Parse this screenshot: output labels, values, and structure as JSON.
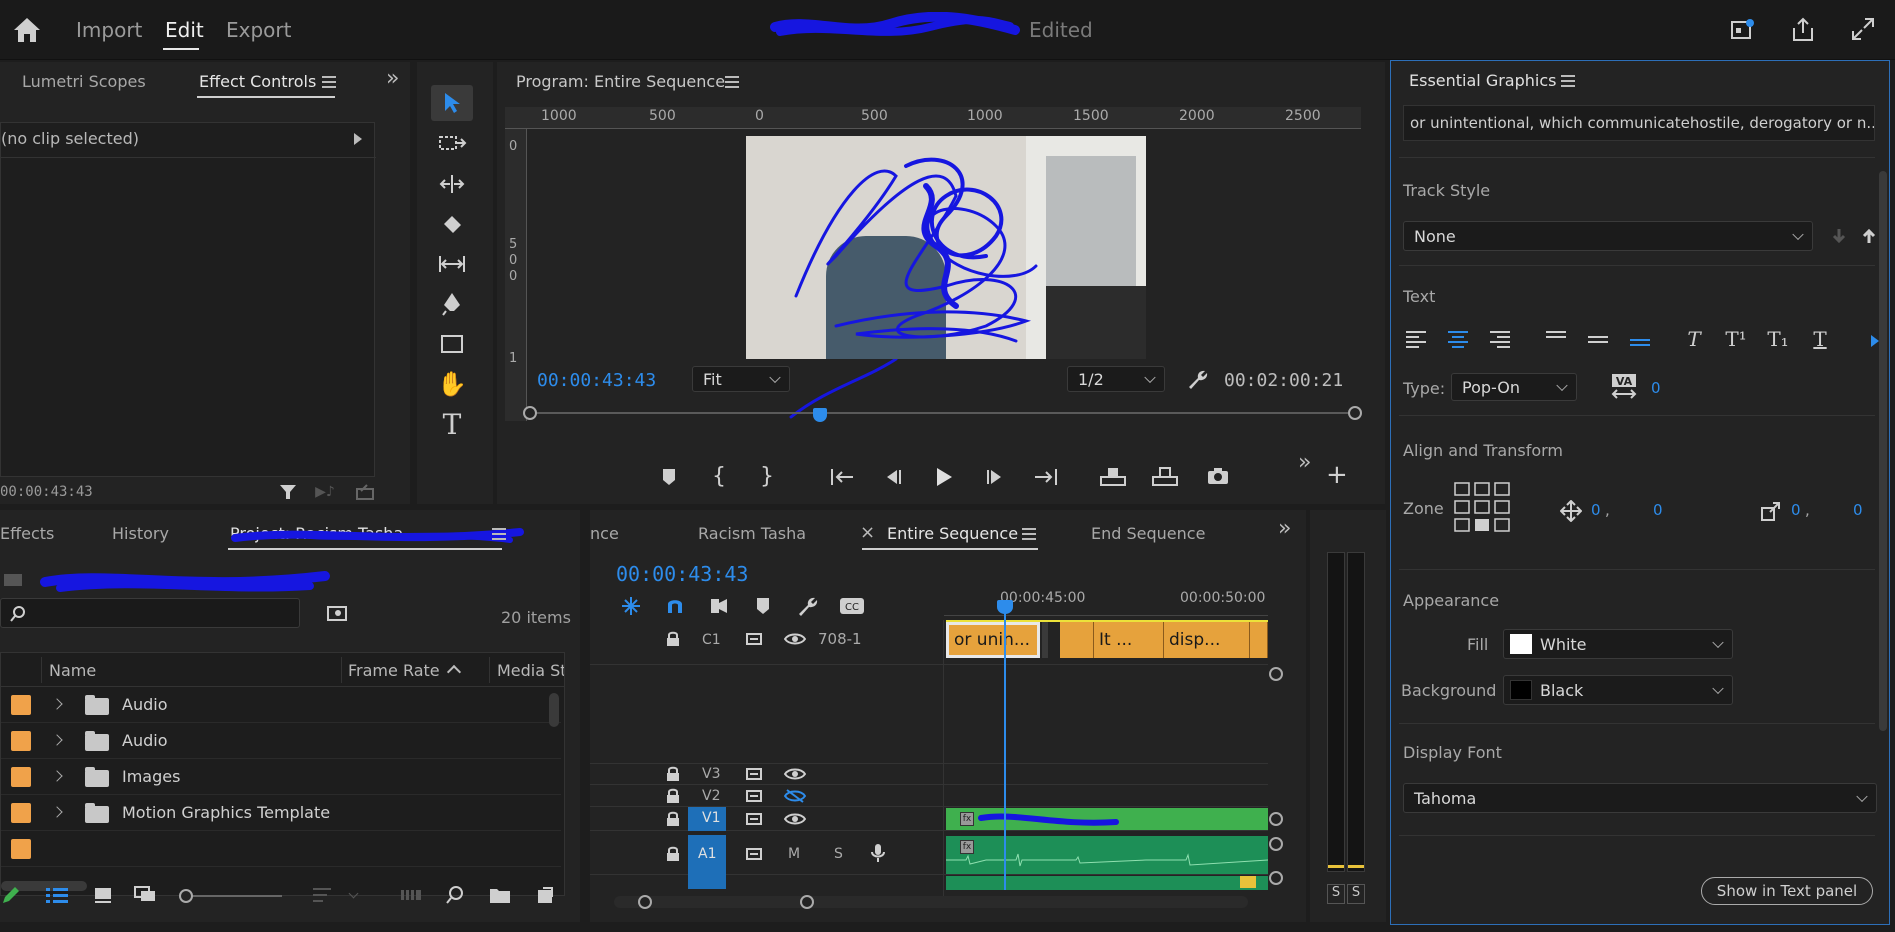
{
  "topbar": {
    "nav": [
      "Import",
      "Edit",
      "Export"
    ],
    "active": "Edit",
    "title_suffix": "Edited"
  },
  "left_panel": {
    "tabs": [
      "Lumetri Scopes",
      "Effect Controls"
    ],
    "no_clip": "(no clip selected)",
    "timecode": "00:00:43:43"
  },
  "program": {
    "title": "Program: Entire Sequence",
    "ruler": [
      "1000",
      "500",
      "0",
      "500",
      "1000",
      "1500",
      "2000",
      "2500"
    ],
    "side_ruler": [
      "0",
      "5",
      "0",
      "0",
      "1"
    ],
    "current_tc": "00:00:43:43",
    "fit": "Fit",
    "resolution": "1/2",
    "duration_tc": "00:02:00:21"
  },
  "project_panel": {
    "tabs": [
      "Effects",
      "History",
      "Project: Racism Tasha"
    ],
    "items_count": "20 items",
    "columns": [
      "Name",
      "Frame Rate",
      "Media St"
    ],
    "rows": [
      "Audio",
      "Audio",
      "Images",
      "Motion Graphics Template"
    ],
    "search_placeholder": ""
  },
  "timeline": {
    "tabs": [
      "nce",
      "Racism Tasha",
      "Entire Sequence",
      "End Sequence"
    ],
    "active_tab": "Entire Sequence",
    "timecode": "00:00:43:43",
    "ruler": [
      "00:00:45:00",
      "00:00:50:00"
    ],
    "tracks": {
      "c1": "C1",
      "c1_name": "708-1",
      "v3": "V3",
      "v2": "V2",
      "v1": "V1",
      "a1": "A1",
      "a1_m": "M",
      "a1_s": "S"
    },
    "clips": [
      "or unin...",
      "It ...",
      "disp..."
    ]
  },
  "meters": {
    "s1": "S",
    "s2": "S"
  },
  "essential_graphics": {
    "title": "Essential Graphics",
    "text_field": "or unintentional, which communicatehostile, derogatory or n...",
    "track_style_label": "Track Style",
    "track_style_value": "None",
    "text_label": "Text",
    "type_label": "Type:",
    "type_value": "Pop-On",
    "tracking_value": "0",
    "align_label": "Align and Transform",
    "zone_label": "Zone",
    "pos_x": "0",
    "pos_y": "0",
    "scale_x": "0",
    "scale_y": "0",
    "appearance_label": "Appearance",
    "fill_label": "Fill",
    "fill_value": "White",
    "bg_label": "Background",
    "bg_value": "Black",
    "display_font_label": "Display Font",
    "display_font_value": "Tahoma",
    "show_button": "Show in Text panel"
  },
  "colors": {
    "accent": "#2d8ceb",
    "clip": "#e6a23c",
    "video_clip": "#3fb04e",
    "audio_clip": "#1d8f57",
    "swatch": "#f0a24a"
  }
}
